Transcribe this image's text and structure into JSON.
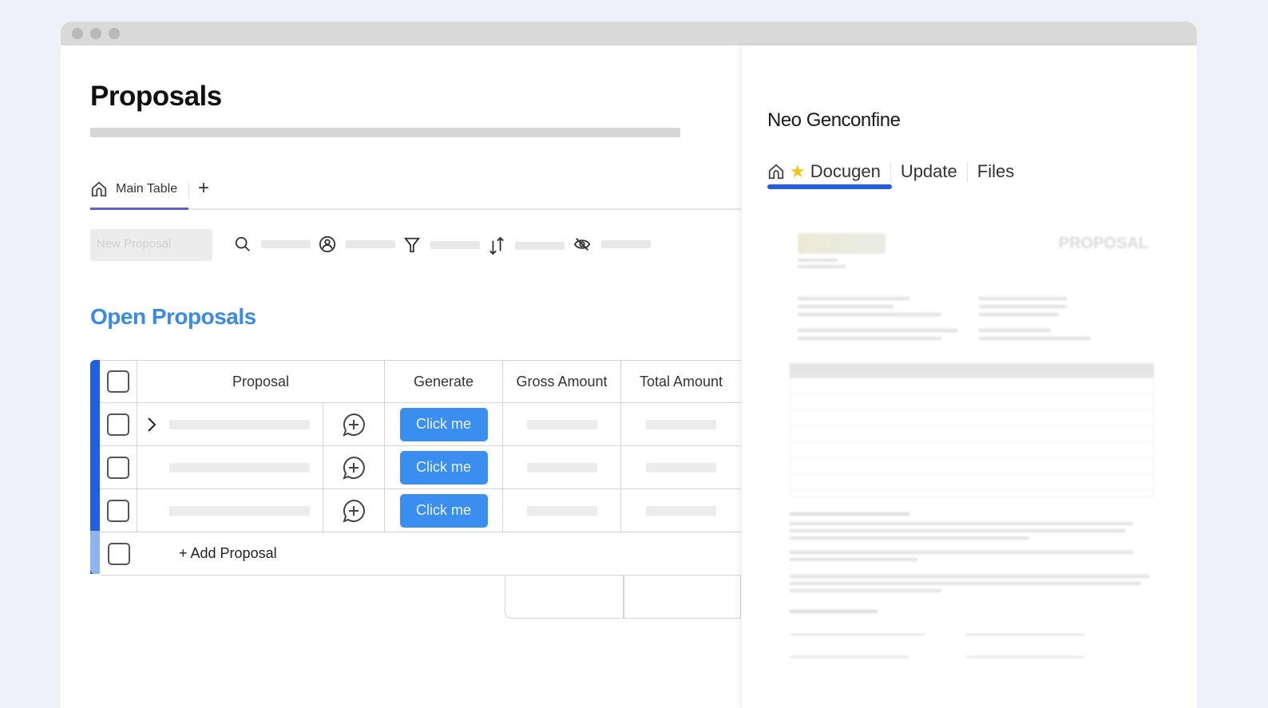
{
  "window": {
    "controls": [
      "close",
      "minimize",
      "maximize"
    ]
  },
  "left": {
    "page_title": "Proposals",
    "tabs": [
      {
        "label": "Main Table",
        "icon": "home-icon",
        "active": true
      }
    ],
    "add_tab_label": "+",
    "toolbar": {
      "new_button_label": "New Proposal",
      "tools": [
        {
          "icon": "search-icon"
        },
        {
          "icon": "person-icon"
        },
        {
          "icon": "filter-icon"
        },
        {
          "icon": "sort-icon"
        },
        {
          "icon": "hide-icon"
        }
      ]
    },
    "section_title": "Open Proposals",
    "section_color": "#3b8ae6",
    "table": {
      "columns": [
        "Proposal",
        "Generate",
        "Gross Amount",
        "Total Amount"
      ],
      "rows": [
        {
          "expandable": true,
          "generate_label": "Click me"
        },
        {
          "expandable": false,
          "generate_label": "Click me"
        },
        {
          "expandable": false,
          "generate_label": "Click me"
        }
      ],
      "add_row_label": "+ Add Proposal"
    }
  },
  "right": {
    "item_title": "Neo Genconfine",
    "tabs": [
      {
        "label": "Docugen",
        "icon": "star-icon",
        "active": true
      },
      {
        "label": "Update"
      },
      {
        "label": "Files"
      }
    ],
    "document": {
      "heading": "PROPOSAL"
    }
  },
  "colors": {
    "accent": "#1f5fe0",
    "button": "#3a8ef0"
  }
}
